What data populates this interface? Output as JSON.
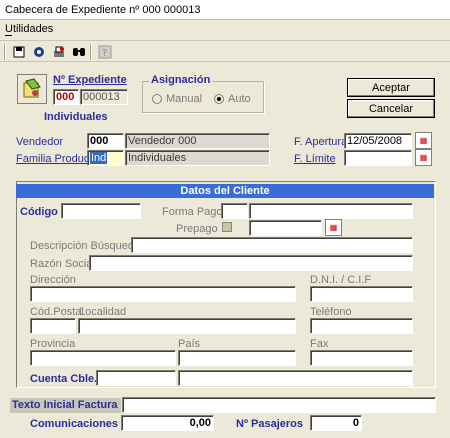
{
  "window": {
    "title": "Cabecera de Expediente nº 000 000013"
  },
  "menu": {
    "utilidades": "Utilidades"
  },
  "toolbar": {
    "icons": [
      "save-icon",
      "view-icon",
      "print-icon",
      "search-icon",
      "help-icon"
    ]
  },
  "expediente": {
    "label": "Nº Expediente",
    "serie": "000",
    "numero": "000013",
    "tipo": "Individuales"
  },
  "asignacion": {
    "title": "Asignación",
    "manual": "Manual",
    "auto": "Auto",
    "selected": "auto"
  },
  "buttons": {
    "aceptar": "Aceptar",
    "cancelar": "Cancelar"
  },
  "vendedor": {
    "label": "Vendedor",
    "code": "000",
    "name": "Vendedor 000"
  },
  "familia": {
    "label": "Familia Producto",
    "code": "Ind",
    "name": "Individuales"
  },
  "fechas": {
    "apertura_label": "F. Apertura",
    "apertura_value": "12/05/2008",
    "limite_label": "F. Límite",
    "limite_value": ""
  },
  "cliente": {
    "header": "Datos del Cliente",
    "codigo_label": "Código",
    "forma_pago_label": "Forma Pago",
    "prepago_label": "Prepago",
    "descripcion_label": "Descripción Búsqueda",
    "razon_label": "Razón Social",
    "direccion_label": "Dirección",
    "dni_label": "D.N.I. / C.I.F",
    "cod_postal_label": "Cód.Postal",
    "localidad_label": "Localidad",
    "telefono_label": "Teléfono",
    "provincia_label": "Provincia",
    "pais_label": "País",
    "fax_label": "Fax",
    "cuenta_label": "Cuenta Cble."
  },
  "footer": {
    "texto_label": "Texto Inicial Factura",
    "texto_value": "",
    "comunicaciones_label": "Comunicaciones",
    "comunicaciones_value": "0,00",
    "pasajeros_label": "Nº Pasajeros",
    "pasajeros_value": "0"
  },
  "colors": {
    "accent": "#3a6cd8",
    "label_blue": "#2c2c9e",
    "red_text": "#c00000"
  }
}
